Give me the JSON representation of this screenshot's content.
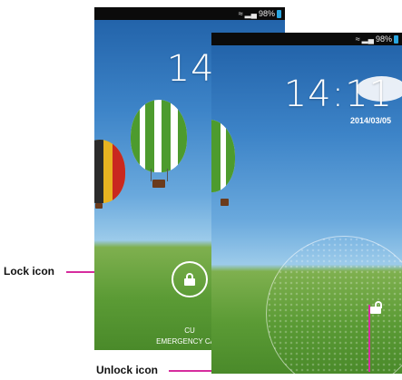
{
  "status": {
    "battery": "98%"
  },
  "lockscreen": {
    "time": "14:11",
    "date": "2014/03/05",
    "carrier": "CU",
    "emergency_call": "EMERGENCY CALL"
  },
  "callouts": {
    "lock_icon": "Lock icon",
    "unlock_icon": "Unlock icon"
  },
  "colors": {
    "callout_line": "#d62c9e",
    "battery": "#2aa6e0",
    "status_bar": "#0b0b0b"
  },
  "icons": [
    "wifi-icon",
    "signal-icon",
    "battery-icon",
    "lock-icon",
    "unlock-icon"
  ]
}
